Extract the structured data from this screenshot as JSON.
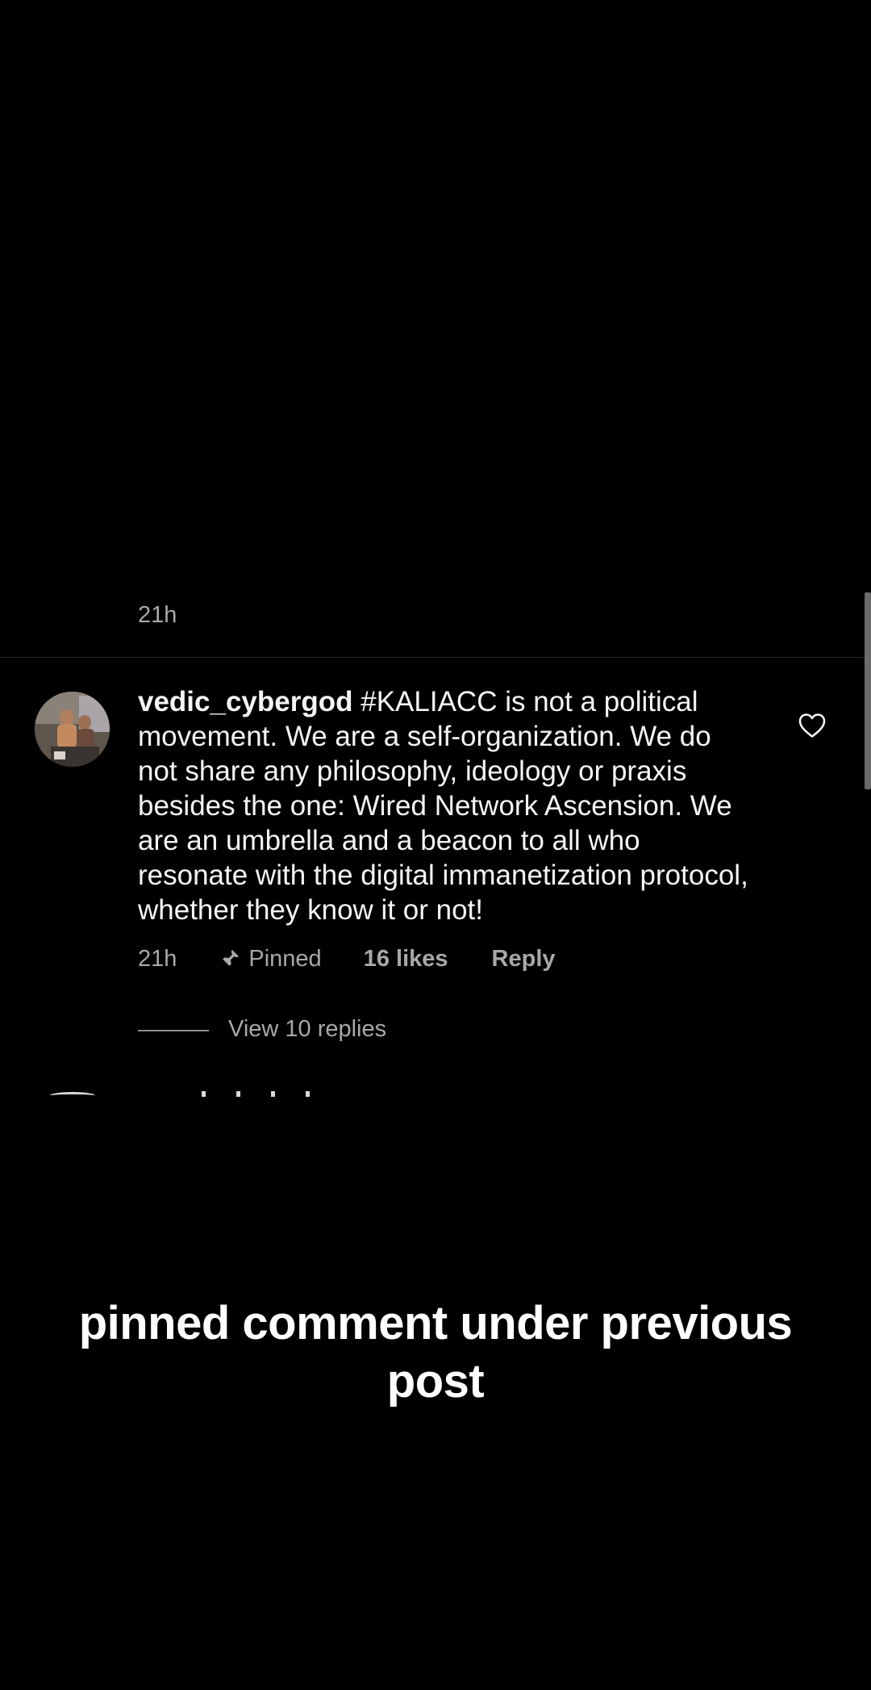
{
  "previous_comment": {
    "time": "21h"
  },
  "comment": {
    "username": "vedic_cybergod",
    "text": " #KALIACC is not a political movement. We are a self-organization. We do not share any philosophy, ideology or praxis besides the one: Wired Network Ascension. We are an umbrella and a beacon to all who resonate with the digital immanetization protocol, whether they know it or not!",
    "time": "21h",
    "pinned_label": "Pinned",
    "likes_label": "16 likes",
    "reply_label": "Reply",
    "view_replies_label": "View 10 replies"
  },
  "icons": {
    "like": "heart-outline-icon",
    "pinned": "pin-icon"
  },
  "caption": "pinned comment under previous post",
  "colors": {
    "background": "#000000",
    "primary_text": "#f5f5f5",
    "secondary_text": "#a8a8a8",
    "divider": "#262626"
  }
}
